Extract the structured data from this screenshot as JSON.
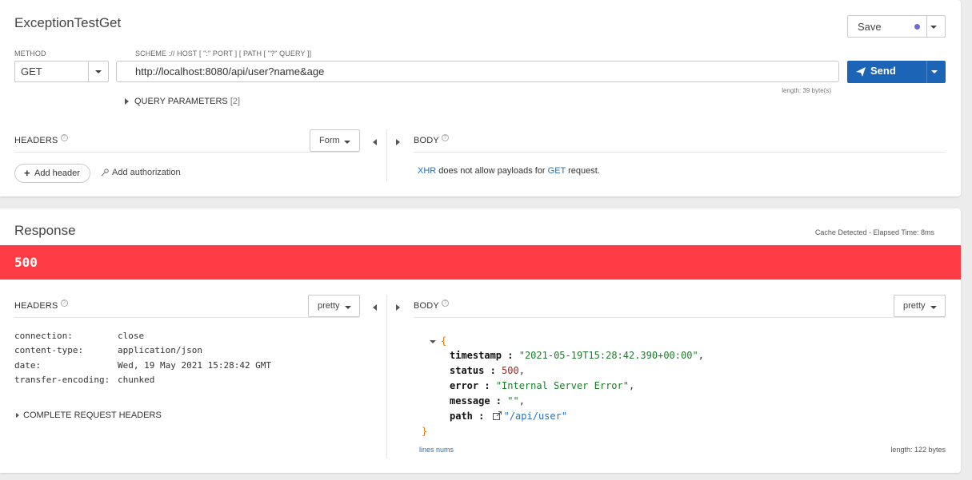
{
  "request": {
    "title": "ExceptionTestGet",
    "save_label": "Save",
    "method_label": "METHOD",
    "method_value": "GET",
    "scheme_label": "SCHEME :// HOST [ \":\" PORT ] [ PATH [ \"?\" QUERY ]]",
    "url": "http://localhost:8080/api/user?name&age",
    "send_label": "Send",
    "length_text": "length: 39 byte(s)",
    "query_params_label": "QUERY PARAMETERS",
    "query_params_count": "[2]",
    "headers_label": "HEADERS",
    "form_label": "Form",
    "body_label": "BODY",
    "add_header_label": "Add header",
    "add_authorization_label": "Add authorization",
    "body_msg": {
      "xhr": "XHR",
      "middle": " does not allow payloads for ",
      "get": "GET",
      "end": " request."
    }
  },
  "response": {
    "title": "Response",
    "cache_text": "Cache Detected - Elapsed Time: 8ms",
    "status_code": "500",
    "status_color": "#ff3b45",
    "headers_label": "HEADERS",
    "pretty_label": "pretty",
    "body_label": "BODY",
    "headers": [
      {
        "key": "connection:",
        "value": "close"
      },
      {
        "key": "content-type:",
        "value": "application/json"
      },
      {
        "key": "date:",
        "value": "Wed, 19 May 2021 15:28:42 GMT"
      },
      {
        "key": "transfer-encoding:",
        "value": "chunked"
      }
    ],
    "complete_headers_label": "COMPLETE REQUEST HEADERS",
    "json": {
      "open": "{",
      "close": "}",
      "timestamp_key": "timestamp",
      "timestamp_val": "\"2021-05-19T15:28:42.390+00:00\"",
      "status_key": "status",
      "status_val": "500",
      "error_key": "error",
      "error_val": "\"Internal Server Error\"",
      "message_key": "message",
      "message_val": "\"\"",
      "path_key": "path",
      "path_val": "\"/api/user\""
    },
    "lines_nums_label": "lines nums",
    "length_text": "length: 122 bytes"
  }
}
